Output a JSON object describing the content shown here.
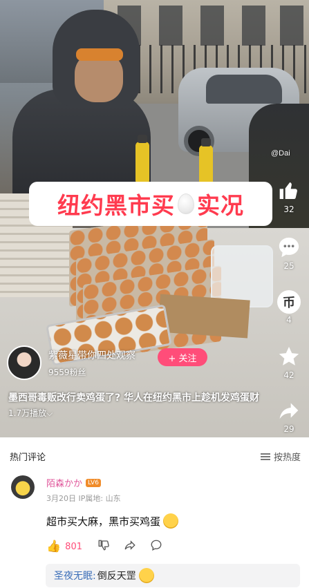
{
  "video": {
    "title_part1": "纽约黑市买",
    "title_part2": "实况",
    "watermark": "@Dai",
    "author": {
      "name": "紫薇星带你四处观察",
      "followers": "9559粉丝",
      "follow_label": "+ 关注"
    },
    "caption": {
      "text": "墨西哥毒贩改行卖鸡蛋了? 华人在纽约黑市上趁机发鸡蛋财",
      "plays": "1.7万播放"
    },
    "actions": {
      "like_count": "32",
      "comment_count": "25",
      "coin_count": "4",
      "star_count": "42",
      "share_count": "29"
    }
  },
  "comments": {
    "header": "热门评论",
    "sort_label": "按热度",
    "items": [
      {
        "username": "陌森かか",
        "level": "LV6",
        "date": "3月20日",
        "location": "IP属地: 山东",
        "text": "超市买大麻，黑市买鸡蛋",
        "likes": "801",
        "reply": {
          "username": "圣夜无眠:",
          "text": "倒反天罡"
        }
      }
    ]
  },
  "colors": {
    "accent": "#ff4d79",
    "title_red": "#ff3b4f",
    "username_pink": "#e0559a",
    "reply_blue": "#3b6eb8"
  }
}
